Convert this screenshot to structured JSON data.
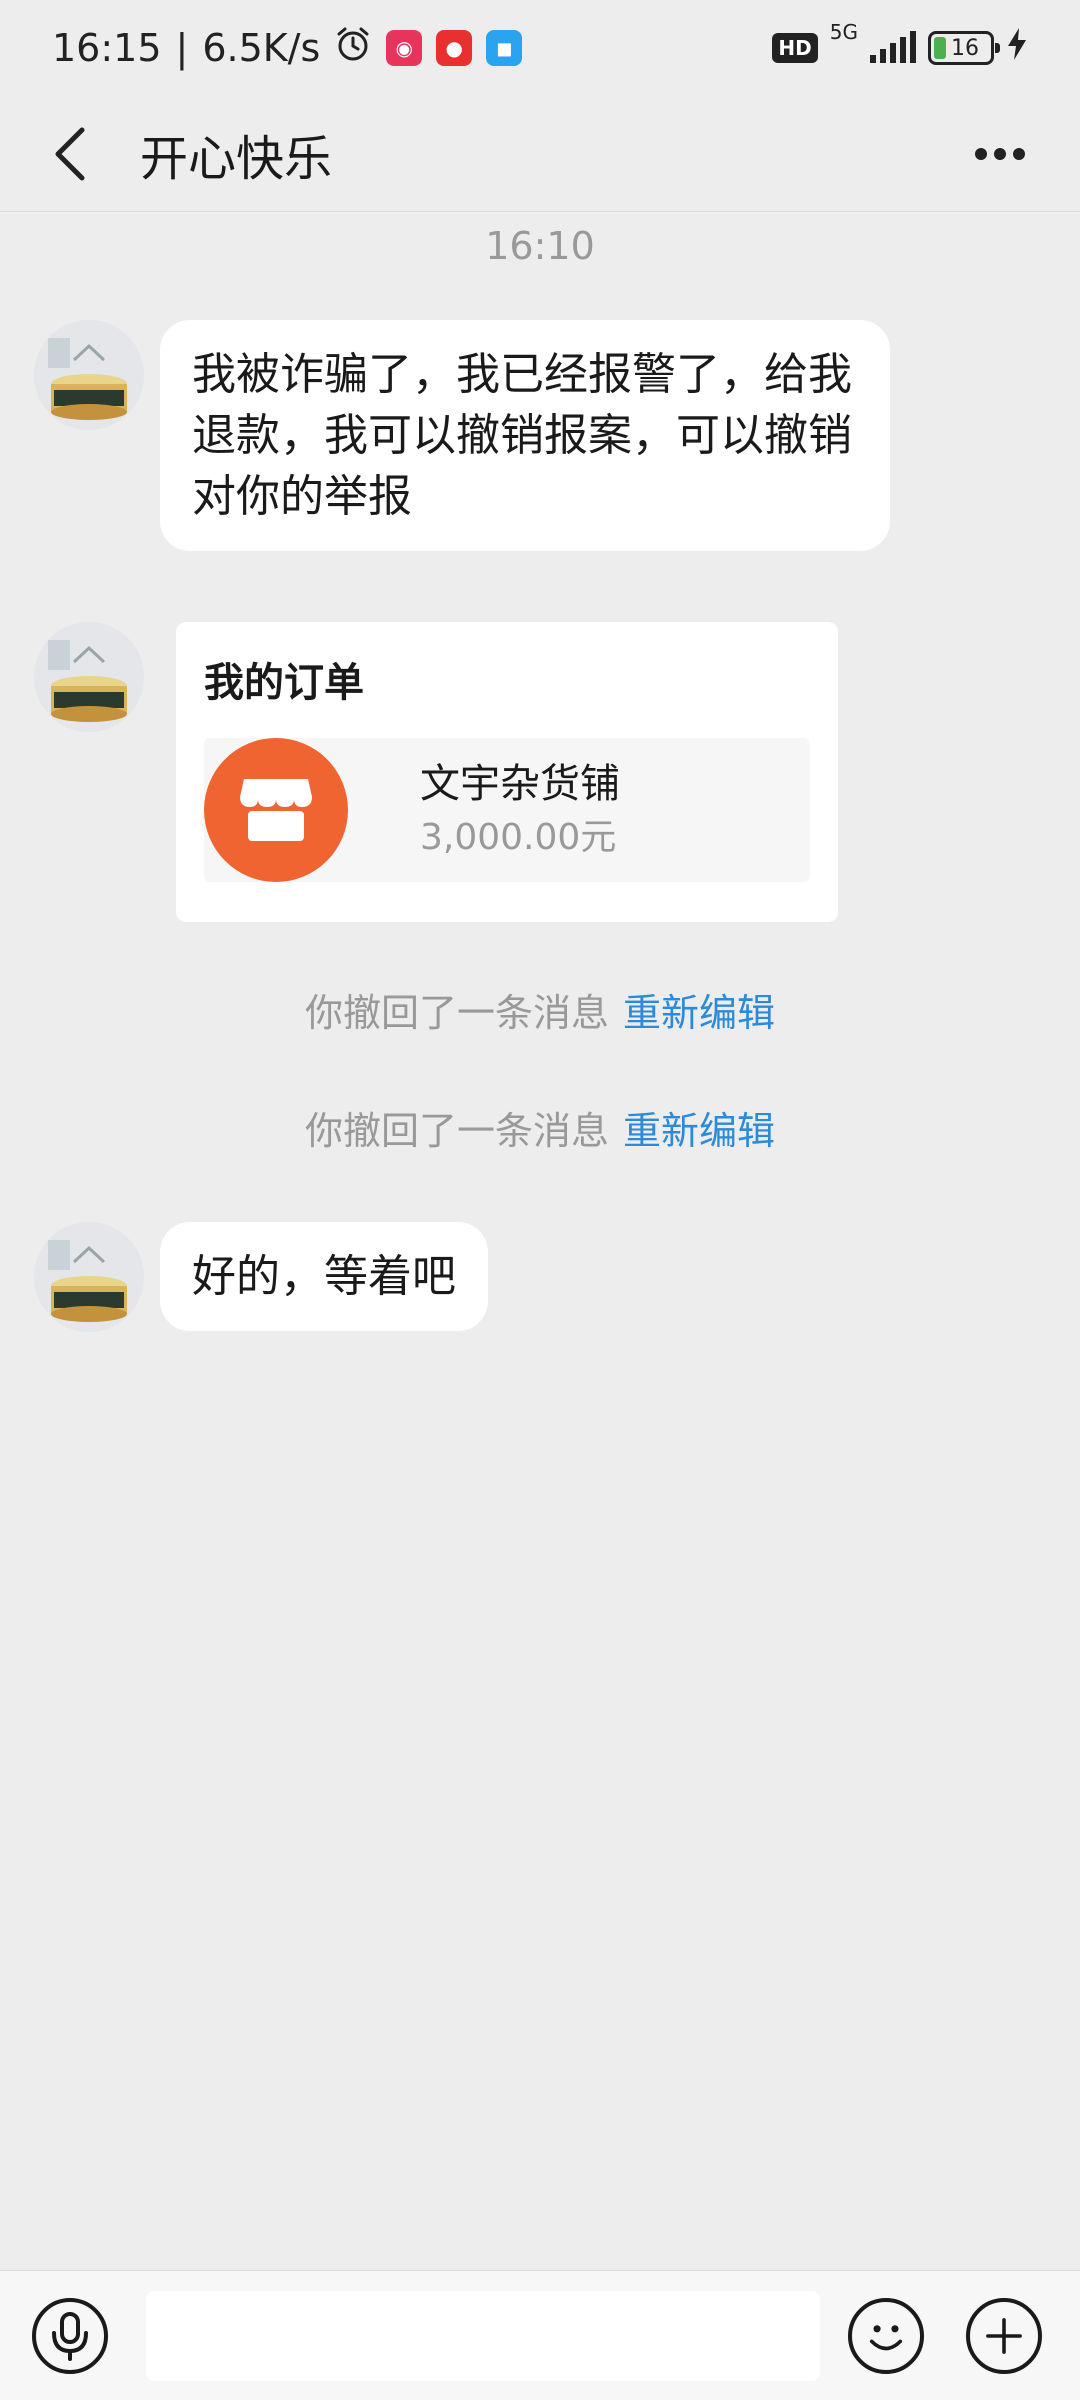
{
  "status_bar": {
    "time": "16:15",
    "network_speed": "6.5K/s",
    "network_type": "5G",
    "hd_label": "HD",
    "battery": "16",
    "icons": [
      "alarm-icon",
      "app-badge-icon",
      "red-envelope-icon",
      "message-bubble-icon"
    ]
  },
  "header": {
    "title": "开心快乐"
  },
  "chat": {
    "timestamp": "16:10",
    "messages": [
      {
        "type": "text",
        "text": "我被诈骗了，我已经报警了，给我退款，我可以撤销报案，可以撤销对你的举报"
      },
      {
        "type": "order",
        "title": "我的订单",
        "shop_name": "文宇杂货铺",
        "price": "3,000.00元"
      },
      {
        "type": "system",
        "text": "你撤回了一条消息",
        "link": "重新编辑"
      },
      {
        "type": "system",
        "text": "你撤回了一条消息",
        "link": "重新编辑"
      },
      {
        "type": "text",
        "text": "好的，等着吧"
      }
    ]
  },
  "input_bar": {
    "placeholder": ""
  },
  "colors": {
    "background": "#ededed",
    "bubble": "#ffffff",
    "link": "#2d8ad9",
    "shop_icon": "#f06431"
  }
}
